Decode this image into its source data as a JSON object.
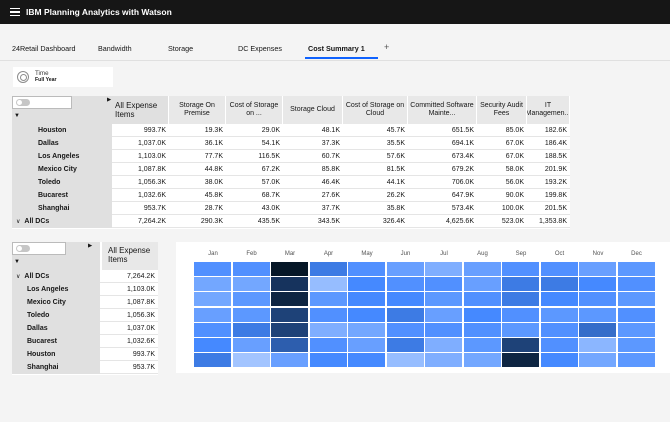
{
  "app": {
    "title": "IBM Planning Analytics with Watson"
  },
  "tabs": [
    {
      "label": "24Retail Dashboard"
    },
    {
      "label": "Bandwidth"
    },
    {
      "label": "Storage"
    },
    {
      "label": "DC Expenses"
    },
    {
      "label": "Cost Summary 1",
      "active": true
    }
  ],
  "tab_add": "+",
  "time_filter": {
    "label": "Time",
    "value": "Full Year"
  },
  "grid1": {
    "headers": [
      "All Expense Items",
      "Storage On Premise",
      "Cost of Storage on ...",
      "Storage Cloud",
      "Cost of Storage on Cloud",
      "Committed Software Mainte...",
      "Security Audit Fees",
      "IT Managemen..."
    ],
    "rows": [
      {
        "label": "Houston",
        "values": [
          "993.7K",
          "19.3K",
          "29.0K",
          "48.1K",
          "45.7K",
          "651.5K",
          "85.0K",
          "182.6K"
        ]
      },
      {
        "label": "Dallas",
        "values": [
          "1,037.0K",
          "36.1K",
          "54.1K",
          "37.3K",
          "35.5K",
          "694.1K",
          "67.0K",
          "186.4K"
        ]
      },
      {
        "label": "Los Angeles",
        "values": [
          "1,103.0K",
          "77.7K",
          "116.5K",
          "60.7K",
          "57.6K",
          "673.4K",
          "67.0K",
          "188.5K"
        ]
      },
      {
        "label": "Mexico City",
        "values": [
          "1,087.8K",
          "44.8K",
          "67.2K",
          "85.8K",
          "81.5K",
          "679.2K",
          "58.0K",
          "201.9K"
        ]
      },
      {
        "label": "Toledo",
        "values": [
          "1,056.3K",
          "38.0K",
          "57.0K",
          "46.4K",
          "44.1K",
          "706.0K",
          "56.0K",
          "193.2K"
        ]
      },
      {
        "label": "Bucarest",
        "values": [
          "1,032.6K",
          "45.8K",
          "68.7K",
          "27.6K",
          "26.2K",
          "647.9K",
          "90.0K",
          "199.8K"
        ]
      },
      {
        "label": "Shanghai",
        "values": [
          "953.7K",
          "28.7K",
          "43.0K",
          "37.7K",
          "35.8K",
          "573.4K",
          "100.0K",
          "201.5K"
        ]
      }
    ],
    "total": {
      "label": "All DCs",
      "values": [
        "7,264.2K",
        "290.3K",
        "435.5K",
        "343.5K",
        "326.4K",
        "4,625.6K",
        "523.0K",
        "1,353.8K"
      ]
    }
  },
  "grid2": {
    "header": "All Expense Items",
    "total": {
      "label": "All DCs",
      "value": "7,264.2K"
    },
    "rows": [
      {
        "label": "Los Angeles",
        "value": "1,103.0K"
      },
      {
        "label": "Mexico City",
        "value": "1,087.8K"
      },
      {
        "label": "Toledo",
        "value": "1,056.3K"
      },
      {
        "label": "Dallas",
        "value": "1,037.0K"
      },
      {
        "label": "Bucarest",
        "value": "1,032.6K"
      },
      {
        "label": "Houston",
        "value": "993.7K"
      },
      {
        "label": "Shanghai",
        "value": "953.7K"
      }
    ]
  },
  "heatmap": {
    "months": [
      "Jan",
      "Feb",
      "Mar",
      "Apr",
      "May",
      "Jun",
      "Jul",
      "Aug",
      "Sep",
      "Oct",
      "Nov",
      "Dec"
    ],
    "levels": [
      [
        0.55,
        0.55,
        1.0,
        0.65,
        0.55,
        0.45,
        0.35,
        0.45,
        0.55,
        0.55,
        0.45,
        0.5
      ],
      [
        0.4,
        0.4,
        0.9,
        0.25,
        0.6,
        0.55,
        0.55,
        0.45,
        0.65,
        0.65,
        0.6,
        0.55
      ],
      [
        0.4,
        0.5,
        0.95,
        0.5,
        0.6,
        0.6,
        0.5,
        0.55,
        0.65,
        0.6,
        0.55,
        0.5
      ],
      [
        0.45,
        0.5,
        0.85,
        0.55,
        0.6,
        0.65,
        0.45,
        0.6,
        0.55,
        0.5,
        0.5,
        0.55
      ],
      [
        0.55,
        0.65,
        0.85,
        0.35,
        0.4,
        0.55,
        0.55,
        0.55,
        0.5,
        0.55,
        0.7,
        0.5
      ],
      [
        0.6,
        0.45,
        0.75,
        0.55,
        0.45,
        0.65,
        0.35,
        0.5,
        0.85,
        0.55,
        0.3,
        0.5
      ],
      [
        0.65,
        0.2,
        0.45,
        0.6,
        0.6,
        0.25,
        0.35,
        0.4,
        0.95,
        0.6,
        0.4,
        0.5
      ]
    ],
    "color_low": "#d0e2ff",
    "color_high": "#061727"
  }
}
